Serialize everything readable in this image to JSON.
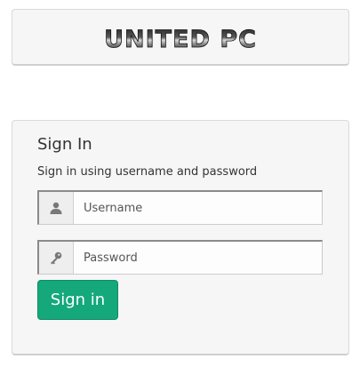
{
  "brand": {
    "logo_text": "UNITED PC"
  },
  "login": {
    "title": "Sign In",
    "subtitle": "Sign in using username and password",
    "username_placeholder": "Username",
    "password_placeholder": "Password",
    "signin_label": "Sign in"
  },
  "icons": {
    "username": "user-icon",
    "password": "key-icon"
  },
  "colors": {
    "accent": "#14a87a",
    "panel_bg": "#f6f6f6",
    "panel_border": "#d9d9d9"
  }
}
